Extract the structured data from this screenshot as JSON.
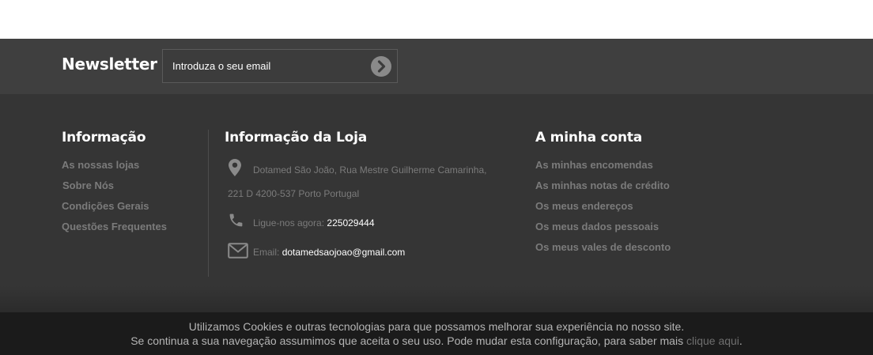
{
  "newsletter": {
    "title": "Newsletter",
    "email_placeholder": "Introduza o seu email",
    "submit_icon": "chevron-right-circle-icon"
  },
  "info_column": {
    "title": "Informação",
    "links": [
      "As nossas lojas",
      "Sobre Nós",
      "Condições Gerais",
      "Questões Frequentes"
    ]
  },
  "store_column": {
    "title": "Informação da Loja",
    "address_line1": "Dotamed São João, Rua Mestre Guilherme Camarinha,",
    "address_line2": "221 D 4200-537 Porto Portugal",
    "phone_label": "Ligue-nos agora:",
    "phone_value": "225029444",
    "email_label": "Email:",
    "email_value": "dotamedsaojoao@gmail.com",
    "icons": [
      "map-pin-icon",
      "phone-icon",
      "envelope-icon"
    ]
  },
  "account_column": {
    "title": "A minha conta",
    "links": [
      "As minhas encomendas",
      "As minhas notas de crédito",
      "Os meus endereços",
      "Os meus dados pessoais",
      "Os meus vales de desconto"
    ]
  },
  "cookie": {
    "line1": "Utilizamos Cookies e outras tecnologias para que possamos melhorar sua experiência no nosso site.",
    "line2": "Se continua a sua navegação assumimos que aceita o seu uso. Pode mudar esta configuração, para saber mais",
    "link_text": "clique aqui",
    "trailing": "."
  },
  "colors": {
    "newsletter_bg": "#3f3f3f",
    "footer_bg": "#353535",
    "cookie_bg": "#1b1b1b",
    "link_gray": "#7b7b7b"
  }
}
